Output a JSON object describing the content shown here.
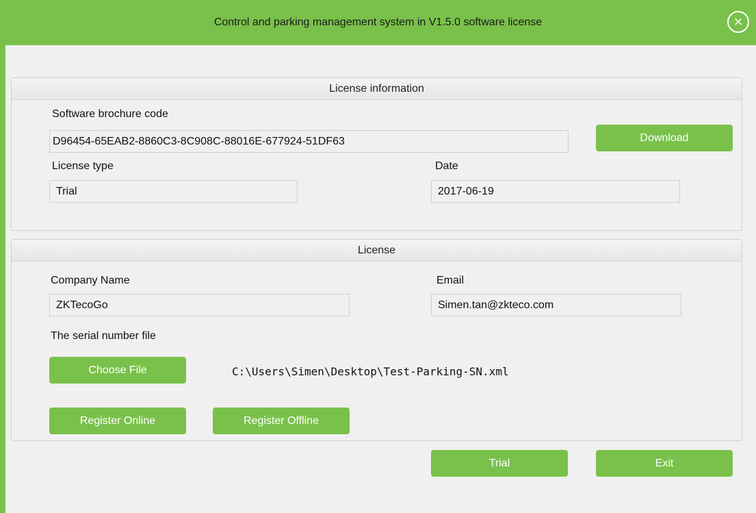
{
  "window": {
    "title": "Control and parking management system in V1.5.0 software license",
    "close_icon": "×"
  },
  "license_info": {
    "header": "License information",
    "code_label": "Software brochure code",
    "code_value": "D96454-65EAB2-8860C3-8C908C-88016E-677924-51DF63",
    "download_label": "Download",
    "type_label": "License type",
    "type_value": "Trial",
    "date_label": "Date",
    "date_value": "2017-06-19"
  },
  "license": {
    "header": "License",
    "company_label": "Company Name",
    "company_value": "ZKTecoGo",
    "email_label": "Email",
    "email_value": "Simen.tan@zkteco.com",
    "serial_label": "The serial number file",
    "choose_file_label": "Choose File",
    "file_path": "C:\\Users\\Simen\\Desktop\\Test-Parking-SN.xml",
    "register_online_label": "Register Online",
    "register_offline_label": "Register Offline"
  },
  "footer": {
    "trial_label": "Trial",
    "exit_label": "Exit"
  },
  "colors": {
    "accent": "#79c14a",
    "background": "#f0f0f0"
  }
}
